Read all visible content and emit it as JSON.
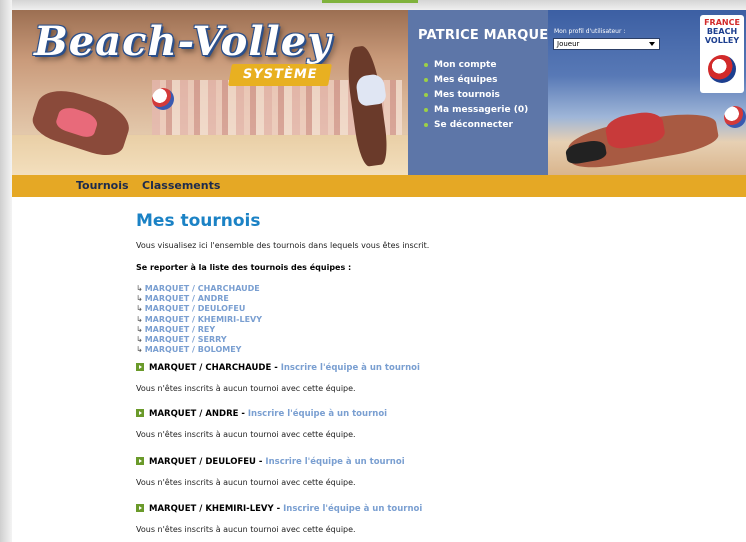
{
  "banner": {
    "logo_title": "Beach-Volley",
    "logo_subtitle": "SYSTÈME",
    "federation_logo_lines": [
      "FRANCE",
      "BEACH",
      "VOLLEY"
    ],
    "user_name": "PATRICE MARQUET",
    "user_menu": [
      {
        "label": "Mon compte"
      },
      {
        "label": "Mes équipes"
      },
      {
        "label": "Mes tournois"
      },
      {
        "label": "Ma messagerie (0)"
      },
      {
        "label": "Se déconnecter"
      }
    ],
    "profile_label": "Mon profil d'utilisateur :",
    "profile_value": "Joueur"
  },
  "nav": {
    "items": [
      {
        "label": "Tournois"
      },
      {
        "label": "Classements"
      }
    ]
  },
  "main": {
    "title": "Mes tournois",
    "intro": "Vous visualisez ici l'ensemble des tournois dans lequels vous êtes inscrit.",
    "subhead": "Se reporter à la liste des tournois des équipes :",
    "team_links": [
      "MARQUET / CHARCHAUDE",
      "MARQUET / ANDRE",
      "MARQUET / DEULOFEU",
      "MARQUET / KHEMIRI-LEVY",
      "MARQUET / REY",
      "MARQUET / SERRY",
      "MARQUET / BOLOMEY"
    ],
    "team_blocks": [
      {
        "team": "MARQUET / CHARCHAUDE",
        "link": "Inscrire l'équipe à un tournoi",
        "message": "Vous n'êtes inscrits à aucun tournoi avec cette équipe."
      },
      {
        "team": "MARQUET / ANDRE",
        "link": "Inscrire l'équipe à un tournoi",
        "message": "Vous n'êtes inscrits à aucun tournoi avec cette équipe."
      },
      {
        "team": "MARQUET / DEULOFEU",
        "link": "Inscrire l'équipe à un tournoi",
        "message": "Vous n'êtes inscrits à aucun tournoi avec cette équipe."
      },
      {
        "team": "MARQUET / KHEMIRI-LEVY",
        "link": "Inscrire l'équipe à un tournoi",
        "message": "Vous n'êtes inscrits à aucun tournoi avec cette équipe."
      }
    ],
    "separator": " - "
  },
  "colors": {
    "title_blue": "#1b82c5",
    "link_blue": "#7a9fd1",
    "nav_gold": "#e5a825",
    "panel_blue": "#5d76a8",
    "bullet_green": "#6a9a2a"
  }
}
